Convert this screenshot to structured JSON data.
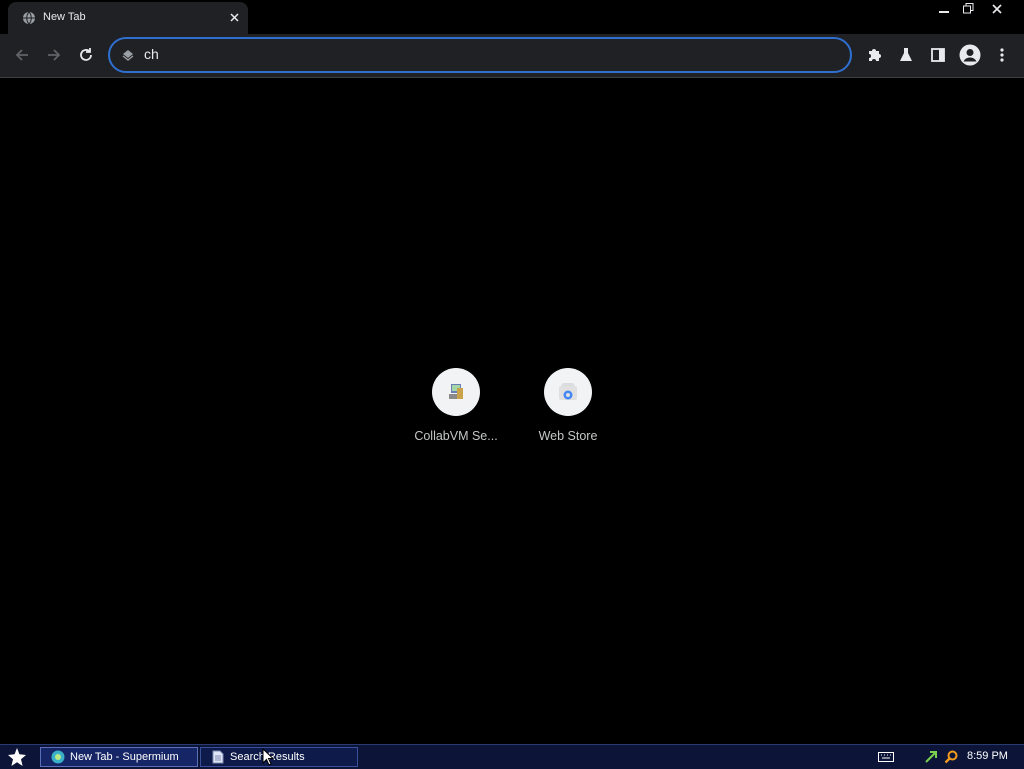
{
  "tab": {
    "title": "New Tab",
    "favicon": "globe-icon"
  },
  "omnibox": {
    "value": "ch",
    "icon": "page-icon"
  },
  "toolbar": {
    "back": "arrow-left-icon",
    "forward": "arrow-right-icon",
    "reload": "reload-icon",
    "extensions": "puzzle-icon",
    "labs": "flask-icon",
    "side_panel": "side-panel-icon",
    "profile": "avatar-icon",
    "menu": "more-vert-icon"
  },
  "shortcuts": [
    {
      "label": "CollabVM Se...",
      "icon": "computer-icon"
    },
    {
      "label": "Web Store",
      "icon": "web-store-icon"
    }
  ],
  "taskbar": {
    "start": "start-star-icon",
    "tasks": [
      {
        "label": "New Tab - Supermium",
        "icon": "supermium-icon"
      },
      {
        "label": "Search Results",
        "icon": "document-icon"
      }
    ],
    "tray": [
      "keyboard-icon",
      "network-icon",
      "search-icon"
    ],
    "clock": "8:59 PM"
  },
  "colors": {
    "accent": "#2f6fd0",
    "taskbar": "#0c1538",
    "toolbar": "#202124"
  }
}
